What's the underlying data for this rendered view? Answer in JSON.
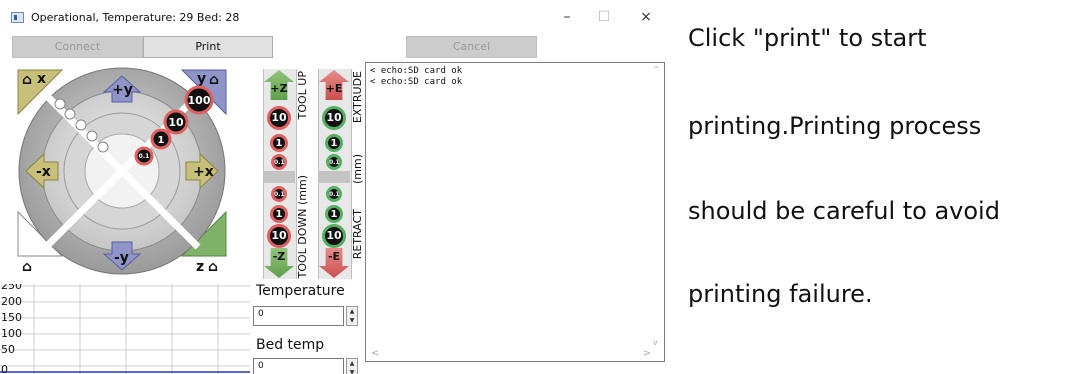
{
  "window": {
    "title": "Operational, Temperature: 29 Bed: 28",
    "controls": {
      "minimize": "–",
      "maximize": "☐",
      "close": "×"
    }
  },
  "toolbar": {
    "connect_label": "Connect",
    "print_label": "Print",
    "cancel_label": "Cancel"
  },
  "xy_pad": {
    "home_x": "x",
    "home_y": "y",
    "home_z": "z",
    "plus_y": "+y",
    "minus_y": "-y",
    "minus_x": "-x",
    "plus_x": "+x",
    "steps": [
      "100",
      "10",
      "1",
      "0.1"
    ]
  },
  "z_column": {
    "up_label": "+Z",
    "down_label": "-Z",
    "steps_up": [
      "10",
      "1",
      "0.1"
    ],
    "steps_down": [
      "0.1",
      "1",
      "10"
    ],
    "side_top": "TOOL UP",
    "side_mid": "(mm)",
    "side_bottom": "TOOL DOWN (mm)"
  },
  "e_column": {
    "up_label": "+E",
    "down_label": "-E",
    "steps_up": [
      "10",
      "1",
      "0.1"
    ],
    "steps_down": [
      "0.1",
      "1",
      "10"
    ],
    "side_top": "EXTRUDE",
    "side_mid": "(mm)",
    "side_bottom": "RETRACT"
  },
  "graph": {
    "ticks": [
      "250",
      "200",
      "150",
      "100",
      "50",
      "0"
    ]
  },
  "temperature": {
    "label": "Temperature",
    "value": "0",
    "bed_label": "Bed temp",
    "bed_value": "0"
  },
  "log": {
    "lines": [
      "< echo:SD card ok",
      "< echo:SD card ok"
    ]
  },
  "instructions": {
    "line1": "Click \"print\" to start",
    "line2": "printing.Printing process",
    "line3": "should be careful to avoid",
    "line4": "printing failure."
  },
  "colors": {
    "z_arrow": "#6fae57",
    "e_arrow": "#d25a5a",
    "y_tile": "#8f95c9",
    "x_tile": "#c8c07a",
    "z_tile": "#7fb36a",
    "graph_line": "#2233cc"
  }
}
